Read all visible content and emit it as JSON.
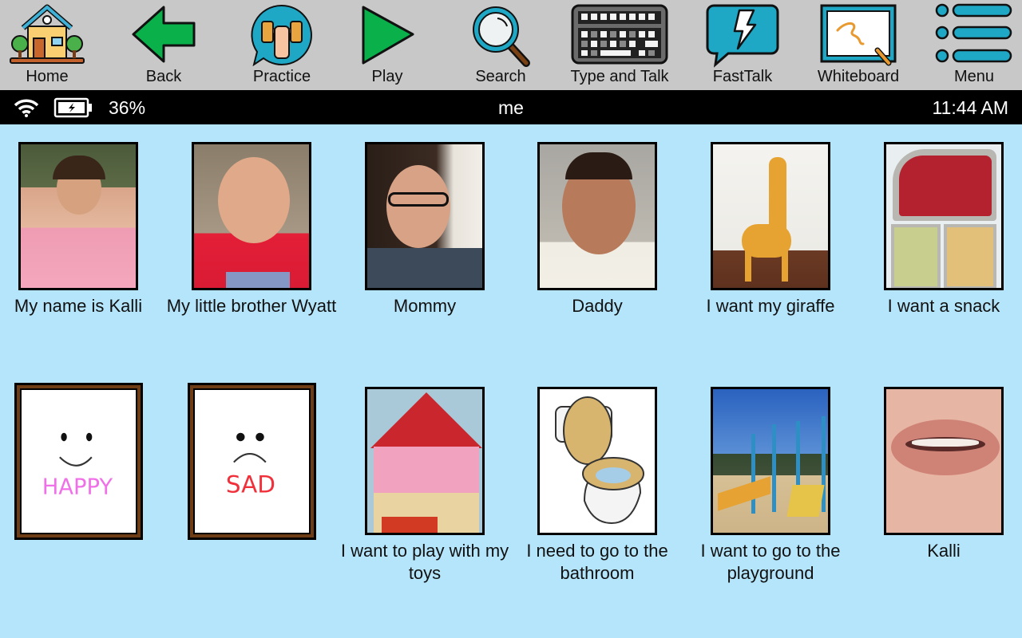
{
  "toolbar": {
    "items": [
      {
        "label": "Home",
        "icon": "house-icon"
      },
      {
        "label": "Back",
        "icon": "arrow-left-icon"
      },
      {
        "label": "Practice",
        "icon": "dumbbell-icon"
      },
      {
        "label": "Play",
        "icon": "play-icon"
      },
      {
        "label": "Search",
        "icon": "magnifier-icon"
      },
      {
        "label": "Type and Talk",
        "icon": "keyboard-icon"
      },
      {
        "label": "FastTalk",
        "icon": "lightning-bubble-icon"
      },
      {
        "label": "Whiteboard",
        "icon": "whiteboard-icon"
      },
      {
        "label": "Menu",
        "icon": "menu-list-icon"
      }
    ]
  },
  "status": {
    "battery_percent": "36%",
    "page_title": "me",
    "time": "11:44 AM"
  },
  "grid": {
    "cells": [
      {
        "label": "My name is Kalli",
        "image": "photo of smiling girl in pink shirt"
      },
      {
        "label": "My little brother Wyatt",
        "image": "photo of smiling toddler in red shirt"
      },
      {
        "label": "Mommy",
        "image": "photo of smiling woman with glasses"
      },
      {
        "label": "Daddy",
        "image": "photo of smiling man in white shirt"
      },
      {
        "label": "I want my giraffe",
        "image": "photo of toy giraffe"
      },
      {
        "label": "I want a snack",
        "image": "photo of strawberries and crackers lunchbox"
      },
      {
        "label": "",
        "image": "happy face drawing",
        "drawing_text": "HAPPY"
      },
      {
        "label": "",
        "image": "sad face drawing",
        "drawing_text": "SAD"
      },
      {
        "label": "I want to play with my toys",
        "image": "photo of dollhouse"
      },
      {
        "label": "I need to go to the bathroom",
        "image": "toilet illustration"
      },
      {
        "label": "I want to go to the playground",
        "image": "photo of playground"
      },
      {
        "label": "Kalli",
        "image": "photo of lips"
      }
    ]
  },
  "colors": {
    "toolbar_bg": "#c8c8c8",
    "status_bg": "#000000",
    "grid_bg": "#b5e5fb",
    "accent_teal": "#1fa7c6",
    "green": "#0ab04a",
    "frame_brown": "#6e3d15"
  }
}
